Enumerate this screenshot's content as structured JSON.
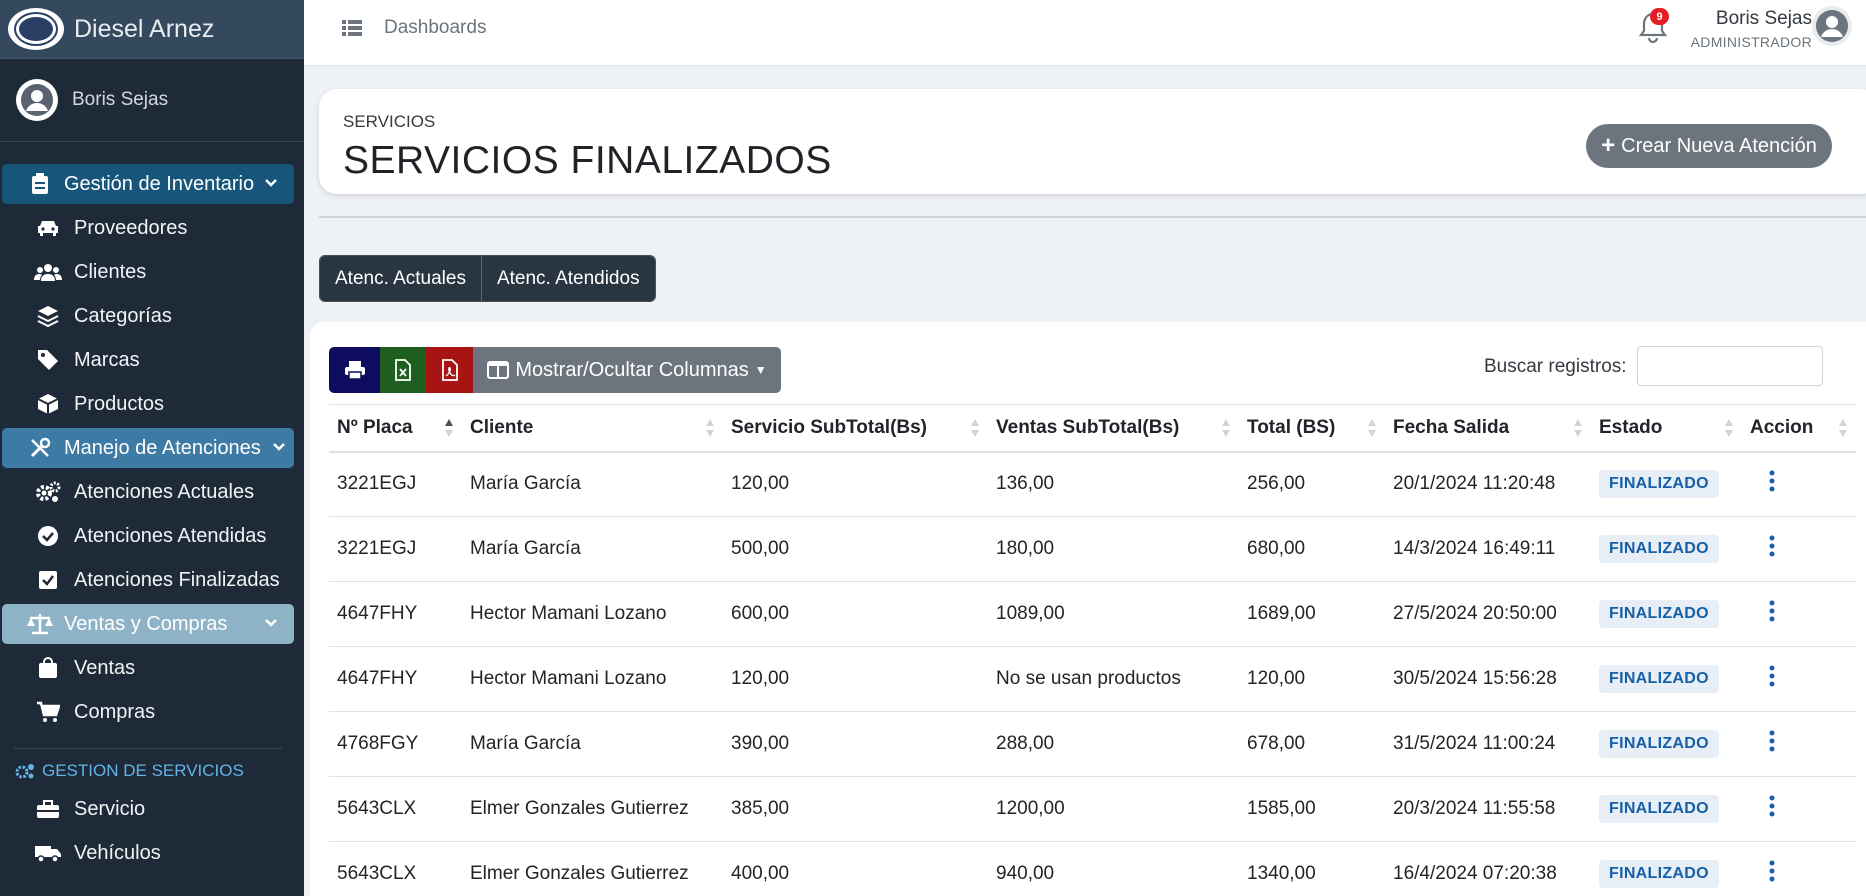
{
  "brand": {
    "name": "Diesel Arnez"
  },
  "sidebar": {
    "user": "Boris Sejas",
    "groups": [
      {
        "label": "Gestión de Inventario",
        "items": [
          "Proveedores",
          "Clientes",
          "Categorías",
          "Marcas",
          "Productos"
        ]
      },
      {
        "label": "Manejo de Atenciones",
        "items": [
          "Atenciones Actuales",
          "Atenciones Atendidas",
          "Atenciones Finalizadas"
        ]
      },
      {
        "label": "Ventas y Compras",
        "items": [
          "Ventas",
          "Compras"
        ]
      }
    ],
    "section": {
      "label": "GESTION DE SERVICIOS",
      "items": [
        "Servicio",
        "Vehículos"
      ]
    }
  },
  "topbar": {
    "breadcrumb": "Dashboards",
    "notifications": "9",
    "user_name": "Boris Sejas",
    "user_role": "ADMINISTRADOR"
  },
  "header": {
    "subtitle": "SERVICIOS",
    "title": "SERVICIOS FINALIZADOS",
    "new_button": "Crear Nueva Atención"
  },
  "tabs": [
    "Atenc. Actuales",
    "Atenc. Atendidos"
  ],
  "toolbar": {
    "columns_button": "Mostrar/Ocultar Columnas",
    "search_label": "Buscar registros:",
    "search_value": ""
  },
  "table": {
    "columns": [
      "Nº Placa",
      "Cliente",
      "Servicio SubTotal(Bs)",
      "Ventas SubTotal(Bs)",
      "Total (BS)",
      "Fecha Salida",
      "Estado",
      "Accion"
    ],
    "rows": [
      [
        "3221EGJ",
        "María García",
        "120,00",
        "136,00",
        "256,00",
        "20/1/2024 11:20:48",
        "FINALIZADO"
      ],
      [
        "3221EGJ",
        "María García",
        "500,00",
        "180,00",
        "680,00",
        "14/3/2024 16:49:11",
        "FINALIZADO"
      ],
      [
        "4647FHY",
        "Hector Mamani Lozano",
        "600,00",
        "1089,00",
        "1689,00",
        "27/5/2024 20:50:00",
        "FINALIZADO"
      ],
      [
        "4647FHY",
        "Hector Mamani Lozano",
        "120,00",
        "No se usan productos",
        "120,00",
        "30/5/2024 15:56:28",
        "FINALIZADO"
      ],
      [
        "4768FGY",
        "María García",
        "390,00",
        "288,00",
        "678,00",
        "31/5/2024 11:00:24",
        "FINALIZADO"
      ],
      [
        "5643CLX",
        "Elmer Gonzales Gutierrez",
        "385,00",
        "1200,00",
        "1585,00",
        "20/3/2024 11:55:58",
        "FINALIZADO"
      ],
      [
        "5643CLX",
        "Elmer Gonzales Gutierrez",
        "400,00",
        "940,00",
        "1340,00",
        "16/4/2024 07:20:38",
        "FINALIZADO"
      ]
    ]
  }
}
